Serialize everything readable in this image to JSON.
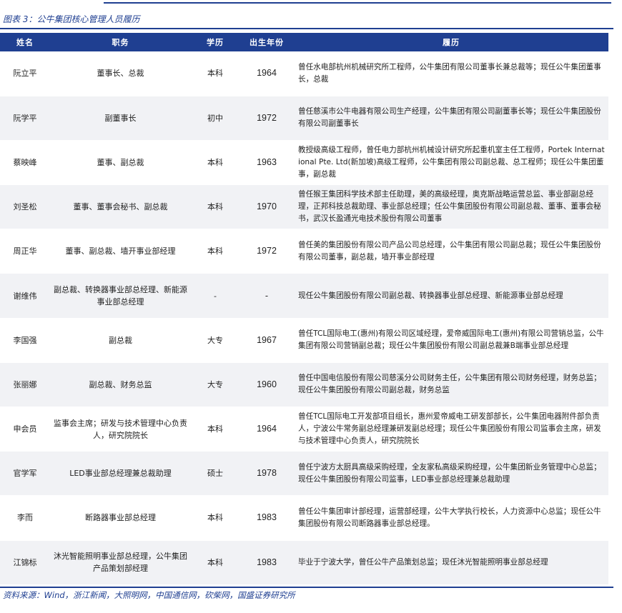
{
  "figure_title": "图表 3：公牛集团核心管理人员履历",
  "headers": {
    "name": "姓名",
    "position": "职务",
    "education": "学历",
    "birth_year": "出生年份",
    "resume": "履历"
  },
  "rows": [
    {
      "name": "阮立平",
      "position": "董事长、总裁",
      "education": "本科",
      "birth_year": "1964",
      "resume": "曾任水电部杭州机械研究所工程师，公牛集团有限公司董事长兼总裁等；现任公牛集团董事长，总裁"
    },
    {
      "name": "阮学平",
      "position": "副董事长",
      "education": "初中",
      "birth_year": "1972",
      "resume": "曾任慈溪市公牛电器有限公司生产经理，公牛集团有限公司副董事长等；现任公牛集团股份有限公司副董事长"
    },
    {
      "name": "蔡映峰",
      "position": "董事、副总裁",
      "education": "本科",
      "birth_year": "1963",
      "resume": "教授级高级工程师，曾任电力部杭州机械设计研究所起重机室主任工程师，Portek International Pte. Ltd(新加坡)高级工程师，公牛集团有限公司副总裁、总工程师；现任公牛集团董事，副总裁"
    },
    {
      "name": "刘圣松",
      "position": "董事、董事会秘书、副总裁",
      "education": "本科",
      "birth_year": "1970",
      "resume": "曾任猴王集团科学技术部主任助理，美的高级经理，奥克斯战略运营总监、事业部副总经理，正邦科技总裁助理、事业部总经理；任公牛集团股份有限公司副总裁、董事、董事会秘书，武汉长盈通光电技术股份有限公司董事"
    },
    {
      "name": "周正华",
      "position": "董事、副总裁、墙开事业部经理",
      "education": "本科",
      "birth_year": "1972",
      "resume": "曾任美的集团股份有限公司产品公司总经理，公牛集团有限公司副总裁；现任公牛集团股份有限公司董事，副总裁，墙开事业部经理"
    },
    {
      "name": "谢维伟",
      "position": "副总裁、转换器事业部总经理、新能源事业部总经理",
      "education": "-",
      "birth_year": "-",
      "resume": "现任公牛集团股份有限公司副总裁、转换器事业部总经理、新能源事业部总经理"
    },
    {
      "name": "李国强",
      "position": "副总裁",
      "education": "大专",
      "birth_year": "1967",
      "resume": "曾任TCL国际电工(惠州)有限公司区域经理，爱帝威国际电工(惠州)有限公司营销总监，公牛集团有限公司营销副总裁；现任公牛集团股份有限公司副总裁兼B端事业部总经理"
    },
    {
      "name": "张丽娜",
      "position": "副总裁、财务总监",
      "education": "大专",
      "birth_year": "1960",
      "resume": "曾任中国电信股份有限公司慈溪分公司财务主任，公牛集团有限公司财务经理，财务总监；现任公牛集团股份有限公司副总裁，财务总监"
    },
    {
      "name": "申会员",
      "position": "监事会主席；研发与技术管理中心负责人，研究院院长",
      "education": "本科",
      "birth_year": "1964",
      "resume": "曾任TCL国际电工开发部项目组长，惠州爱帝威电工研发部部长，公牛集团电器附件部负责人，宁波公牛常务副总经理兼研发副总经理；现任公牛集团股份有限公司监事会主席，研发与技术管理中心负责人，研究院院长"
    },
    {
      "name": "官学军",
      "position": "LED事业部总经理兼总裁助理",
      "education": "硕士",
      "birth_year": "1978",
      "resume": "曾任宁波方太厨具高级采购经理，全友家私高级采购经理，公牛集团新业务管理中心总监；现任公牛集团股份有限公司监事，LED事业部总经理兼总裁助理"
    },
    {
      "name": "李而",
      "position": "断路器事业部总经理",
      "education": "本科",
      "birth_year": "1983",
      "resume": "曾任公牛集团审计部经理，运营部经理，公牛大学执行校长，人力资源中心总监；现任公牛集团股份有限公司断路器事业部总经理。"
    },
    {
      "name": "江锦标",
      "position": "沐光智能照明事业部总经理，公牛集团产品策划部经理",
      "education": "本科",
      "birth_year": "1983",
      "resume": "毕业于宁波大学，曾任公牛产品策划总监；现任沐光智能照明事业部总经理"
    }
  ],
  "source": "资料来源：Wind，浙江新闻，大照明网，中国通信网，砍柴网，国盛证券研究所",
  "colors": {
    "accent": "#1f3f91",
    "row_shade": "#f1f2f5"
  }
}
